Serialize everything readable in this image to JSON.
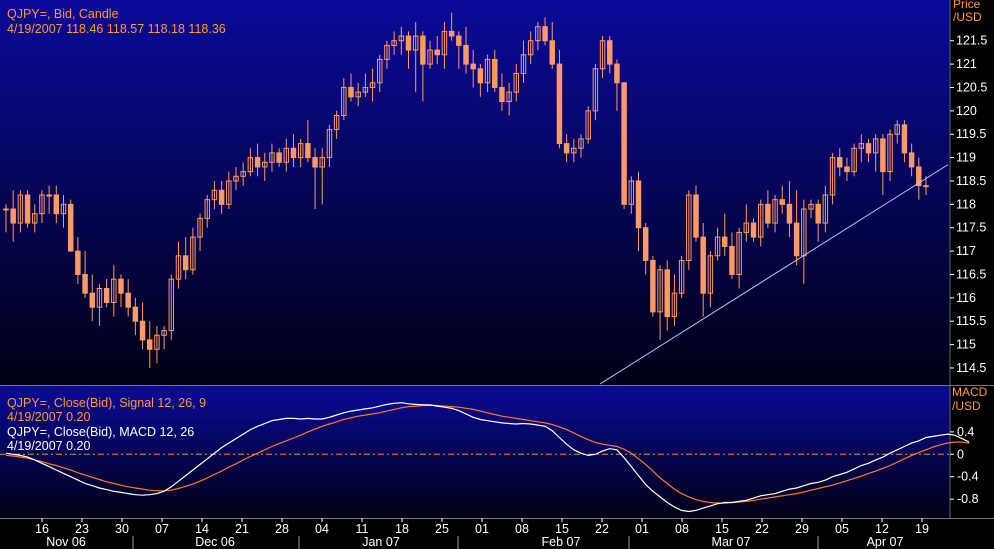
{
  "colors": {
    "bg_top": "#0a0a9a",
    "bg_bottom": "#000014",
    "candle": "#ff9966",
    "info_orange": "#ff9933",
    "info_white": "#ffffff",
    "axis_label": "#ffffff",
    "macd_line": "#ffffff",
    "signal_line": "#ff7a1a",
    "zero_line": "#ff8a2a",
    "trend_line": "#b8c4ff"
  },
  "price_panel": {
    "info_line1": "QJPY=, Bid, Candle",
    "info_line2": "4/19/2007 118.46 118.57 118.18 118.36",
    "axis_title_1": "Price",
    "axis_title_2": "/USD"
  },
  "macd_panel": {
    "info_line1": "QJPY=, Close(Bid), Signal 12, 26, 9",
    "info_line2": "4/19/2007 0.20",
    "info_line3": "QJPY=, Close(Bid), MACD 12, 26",
    "info_line4": "4/19/2007 0.20",
    "axis_title_1": "MACD",
    "axis_title_2": "/USD"
  },
  "chart_data": [
    {
      "type": "candlestick",
      "series_name": "QJPY=, Bid, Candle",
      "ylim": [
        114.2,
        122.2
      ],
      "yticks": [
        114.5,
        115,
        115.5,
        116,
        116.5,
        117,
        117.5,
        118,
        118.5,
        119,
        119.5,
        120,
        120.5,
        121,
        121.5
      ],
      "ytick_labels": [
        "114.5",
        "115",
        "115.5",
        "116",
        "116.5",
        "117",
        "117.5",
        "118",
        "118.5",
        "119",
        "119.5",
        "120",
        "120.5",
        "121",
        "121.5"
      ],
      "candles": [
        [
          117.9,
          118.0,
          117.4,
          117.9
        ],
        [
          117.9,
          118.3,
          117.2,
          117.6
        ],
        [
          117.6,
          118.3,
          117.4,
          118.2
        ],
        [
          118.2,
          118.3,
          117.5,
          117.6
        ],
        [
          117.6,
          118.0,
          117.4,
          117.8
        ],
        [
          117.8,
          118.3,
          117.6,
          118.2
        ],
        [
          118.2,
          118.4,
          117.8,
          118.2
        ],
        [
          118.2,
          118.4,
          117.6,
          117.8
        ],
        [
          117.8,
          118.2,
          117.5,
          118.0
        ],
        [
          118.0,
          118.1,
          117.0,
          117.0
        ],
        [
          117.0,
          117.3,
          116.3,
          116.5
        ],
        [
          116.5,
          117.0,
          116.0,
          116.1
        ],
        [
          116.1,
          116.5,
          115.5,
          115.8
        ],
        [
          115.8,
          116.3,
          115.4,
          116.2
        ],
        [
          116.2,
          116.4,
          115.8,
          115.9
        ],
        [
          115.9,
          116.7,
          115.6,
          116.4
        ],
        [
          116.4,
          116.5,
          115.8,
          116.1
        ],
        [
          116.1,
          116.4,
          115.6,
          115.8
        ],
        [
          115.8,
          116.0,
          115.2,
          115.5
        ],
        [
          115.5,
          115.9,
          114.9,
          115.1
        ],
        [
          115.1,
          115.5,
          114.5,
          114.9
        ],
        [
          114.9,
          115.4,
          114.6,
          115.2
        ],
        [
          115.2,
          115.4,
          114.9,
          115.3
        ],
        [
          115.3,
          116.5,
          115.1,
          116.4
        ],
        [
          116.4,
          117.2,
          116.2,
          116.9
        ],
        [
          116.9,
          117.3,
          116.4,
          116.6
        ],
        [
          116.6,
          117.5,
          116.5,
          117.3
        ],
        [
          117.3,
          117.8,
          117.0,
          117.7
        ],
        [
          117.7,
          118.2,
          117.5,
          118.1
        ],
        [
          118.1,
          118.5,
          117.9,
          118.3
        ],
        [
          118.3,
          118.5,
          117.8,
          118.0
        ],
        [
          118.0,
          118.7,
          117.9,
          118.5
        ],
        [
          118.5,
          118.8,
          118.3,
          118.6
        ],
        [
          118.6,
          118.9,
          118.4,
          118.7
        ],
        [
          118.7,
          119.2,
          118.6,
          119.0
        ],
        [
          119.0,
          119.3,
          118.6,
          118.8
        ],
        [
          118.8,
          119.1,
          118.5,
          118.9
        ],
        [
          118.9,
          119.3,
          118.7,
          119.1
        ],
        [
          119.1,
          119.2,
          118.8,
          118.9
        ],
        [
          118.9,
          119.4,
          118.7,
          119.2
        ],
        [
          119.2,
          119.5,
          118.8,
          119.0
        ],
        [
          119.0,
          119.4,
          118.8,
          119.3
        ],
        [
          119.3,
          119.8,
          118.9,
          119.0
        ],
        [
          119.0,
          119.2,
          117.9,
          118.8
        ],
        [
          118.8,
          119.2,
          118.0,
          119.0
        ],
        [
          119.0,
          119.7,
          118.8,
          119.6
        ],
        [
          119.6,
          120.0,
          119.4,
          119.9
        ],
        [
          119.9,
          120.7,
          119.8,
          120.5
        ],
        [
          120.5,
          120.8,
          120.2,
          120.3
        ],
        [
          120.3,
          120.6,
          120.1,
          120.4
        ],
        [
          120.4,
          120.8,
          120.3,
          120.5
        ],
        [
          120.5,
          120.9,
          120.2,
          120.6
        ],
        [
          120.6,
          121.2,
          120.4,
          121.1
        ],
        [
          121.1,
          121.5,
          120.9,
          121.4
        ],
        [
          121.4,
          121.7,
          121.2,
          121.5
        ],
        [
          121.5,
          121.8,
          121.2,
          121.6
        ],
        [
          121.6,
          121.7,
          120.9,
          121.3
        ],
        [
          121.3,
          121.9,
          120.4,
          121.6
        ],
        [
          121.6,
          121.7,
          120.2,
          121.0
        ],
        [
          121.0,
          121.5,
          120.9,
          121.3
        ],
        [
          121.3,
          121.6,
          121.0,
          121.2
        ],
        [
          121.2,
          121.9,
          120.9,
          121.7
        ],
        [
          121.7,
          122.1,
          121.5,
          121.6
        ],
        [
          121.6,
          121.7,
          120.9,
          121.4
        ],
        [
          121.4,
          121.8,
          120.8,
          121.0
        ],
        [
          121.0,
          121.3,
          120.5,
          120.9
        ],
        [
          120.9,
          121.0,
          120.3,
          120.6
        ],
        [
          120.6,
          121.2,
          120.4,
          121.1
        ],
        [
          121.1,
          121.3,
          120.4,
          120.5
        ],
        [
          120.5,
          120.8,
          120.0,
          120.2
        ],
        [
          120.2,
          120.6,
          119.9,
          120.4
        ],
        [
          120.4,
          121.0,
          120.2,
          120.8
        ],
        [
          120.8,
          121.5,
          120.6,
          121.2
        ],
        [
          121.2,
          121.7,
          121.0,
          121.5
        ],
        [
          121.5,
          121.9,
          121.3,
          121.8
        ],
        [
          121.8,
          122.0,
          121.4,
          121.5
        ],
        [
          121.5,
          121.9,
          120.9,
          121.0
        ],
        [
          121.0,
          121.3,
          119.2,
          119.3
        ],
        [
          119.3,
          119.5,
          118.9,
          119.1
        ],
        [
          119.1,
          119.4,
          118.9,
          119.2
        ],
        [
          119.2,
          119.5,
          119.0,
          119.4
        ],
        [
          119.4,
          120.1,
          119.3,
          120.0
        ],
        [
          120.0,
          121.0,
          119.8,
          120.9
        ],
        [
          120.9,
          121.6,
          120.7,
          121.5
        ],
        [
          121.5,
          121.6,
          120.8,
          121.0
        ],
        [
          121.0,
          121.1,
          120.0,
          120.6
        ],
        [
          120.6,
          120.6,
          117.9,
          118.0
        ],
        [
          118.0,
          118.6,
          117.8,
          118.5
        ],
        [
          118.5,
          118.7,
          117.0,
          117.5
        ],
        [
          117.5,
          117.6,
          116.5,
          116.8
        ],
        [
          116.8,
          116.9,
          115.6,
          115.7
        ],
        [
          115.7,
          116.7,
          115.1,
          116.6
        ],
        [
          116.6,
          116.8,
          115.3,
          115.6
        ],
        [
          115.6,
          116.5,
          115.4,
          116.1
        ],
        [
          116.1,
          116.9,
          116.0,
          116.8
        ],
        [
          116.8,
          118.3,
          116.6,
          118.2
        ],
        [
          118.2,
          118.4,
          117.2,
          117.3
        ],
        [
          117.3,
          117.6,
          115.6,
          116.1
        ],
        [
          116.1,
          117.0,
          115.8,
          116.9
        ],
        [
          116.9,
          117.5,
          116.8,
          117.3
        ],
        [
          117.3,
          117.8,
          116.9,
          117.1
        ],
        [
          117.1,
          117.4,
          116.4,
          116.5
        ],
        [
          116.5,
          117.5,
          116.2,
          117.4
        ],
        [
          117.4,
          118.0,
          117.2,
          117.6
        ],
        [
          117.6,
          117.7,
          117.2,
          117.3
        ],
        [
          117.3,
          118.1,
          117.1,
          118.0
        ],
        [
          118.0,
          118.3,
          117.5,
          117.6
        ],
        [
          117.6,
          118.2,
          117.4,
          118.1
        ],
        [
          118.1,
          118.4,
          117.8,
          118.0
        ],
        [
          118.0,
          118.5,
          117.3,
          117.6
        ],
        [
          117.6,
          118.3,
          116.7,
          116.9
        ],
        [
          116.9,
          118.1,
          116.3,
          117.9
        ],
        [
          117.9,
          118.1,
          117.7,
          118.0
        ],
        [
          118.0,
          118.1,
          117.2,
          117.6
        ],
        [
          117.6,
          118.4,
          117.4,
          118.2
        ],
        [
          118.2,
          119.1,
          118.0,
          119.0
        ],
        [
          119.0,
          119.2,
          118.6,
          118.8
        ],
        [
          118.8,
          119.0,
          118.5,
          118.7
        ],
        [
          118.7,
          119.3,
          118.6,
          119.2
        ],
        [
          119.2,
          119.5,
          118.9,
          119.3
        ],
        [
          119.3,
          119.4,
          118.9,
          119.1
        ],
        [
          119.1,
          119.5,
          118.7,
          119.4
        ],
        [
          119.4,
          119.5,
          118.2,
          118.7
        ],
        [
          118.7,
          119.6,
          118.5,
          119.5
        ],
        [
          119.5,
          119.8,
          119.3,
          119.7
        ],
        [
          119.7,
          119.8,
          118.9,
          119.1
        ],
        [
          119.1,
          119.3,
          118.6,
          118.8
        ],
        [
          118.8,
          119.0,
          118.1,
          118.4
        ],
        [
          118.4,
          118.6,
          118.2,
          118.4
        ]
      ]
    },
    {
      "type": "line",
      "ylim": [
        -1.1,
        1.2
      ],
      "yticks": [
        0.4,
        0,
        -0.4,
        -0.8
      ],
      "ytick_labels": [
        "0.4",
        "0",
        "-0.4",
        "-0.8"
      ],
      "zero_line": 0,
      "series": [
        {
          "name": "MACD 12, 26",
          "values": [
            0.02,
            0.0,
            -0.02,
            -0.05,
            -0.1,
            -0.16,
            -0.22,
            -0.28,
            -0.34,
            -0.4,
            -0.46,
            -0.52,
            -0.56,
            -0.6,
            -0.63,
            -0.66,
            -0.68,
            -0.7,
            -0.72,
            -0.73,
            -0.72,
            -0.7,
            -0.66,
            -0.58,
            -0.48,
            -0.38,
            -0.28,
            -0.18,
            -0.08,
            0.02,
            0.12,
            0.2,
            0.28,
            0.36,
            0.44,
            0.5,
            0.55,
            0.6,
            0.62,
            0.64,
            0.64,
            0.63,
            0.64,
            0.63,
            0.63,
            0.66,
            0.7,
            0.74,
            0.77,
            0.79,
            0.81,
            0.83,
            0.86,
            0.89,
            0.91,
            0.92,
            0.9,
            0.89,
            0.88,
            0.88,
            0.86,
            0.84,
            0.82,
            0.78,
            0.72,
            0.66,
            0.62,
            0.6,
            0.58,
            0.56,
            0.55,
            0.54,
            0.55,
            0.54,
            0.52,
            0.5,
            0.42,
            0.3,
            0.18,
            0.08,
            0.02,
            -0.02,
            0.0,
            0.06,
            0.1,
            0.08,
            -0.06,
            -0.22,
            -0.38,
            -0.54,
            -0.66,
            -0.76,
            -0.86,
            -0.94,
            -1.0,
            -1.02,
            -1.0,
            -0.96,
            -0.92,
            -0.88,
            -0.86,
            -0.86,
            -0.84,
            -0.82,
            -0.78,
            -0.74,
            -0.72,
            -0.7,
            -0.66,
            -0.62,
            -0.6,
            -0.56,
            -0.52,
            -0.5,
            -0.46,
            -0.4,
            -0.36,
            -0.32,
            -0.26,
            -0.2,
            -0.16,
            -0.1,
            -0.05,
            0.02,
            0.08,
            0.14,
            0.2,
            0.24,
            0.3,
            0.32,
            0.34,
            0.36,
            0.34,
            0.28,
            0.22
          ]
        },
        {
          "name": "Signal 12, 26, 9",
          "values": [
            -0.02,
            -0.03,
            -0.05,
            -0.07,
            -0.1,
            -0.13,
            -0.17,
            -0.2,
            -0.24,
            -0.28,
            -0.33,
            -0.37,
            -0.41,
            -0.45,
            -0.49,
            -0.52,
            -0.55,
            -0.58,
            -0.6,
            -0.62,
            -0.64,
            -0.65,
            -0.65,
            -0.64,
            -0.61,
            -0.57,
            -0.53,
            -0.48,
            -0.42,
            -0.36,
            -0.3,
            -0.23,
            -0.17,
            -0.1,
            -0.04,
            0.02,
            0.08,
            0.14,
            0.19,
            0.24,
            0.29,
            0.34,
            0.4,
            0.45,
            0.5,
            0.54,
            0.58,
            0.62,
            0.65,
            0.68,
            0.7,
            0.72,
            0.74,
            0.77,
            0.8,
            0.83,
            0.85,
            0.86,
            0.87,
            0.87,
            0.87,
            0.86,
            0.85,
            0.84,
            0.82,
            0.8,
            0.77,
            0.74,
            0.71,
            0.68,
            0.66,
            0.64,
            0.62,
            0.6,
            0.58,
            0.56,
            0.53,
            0.49,
            0.44,
            0.38,
            0.32,
            0.26,
            0.21,
            0.18,
            0.16,
            0.14,
            0.09,
            0.02,
            -0.08,
            -0.18,
            -0.3,
            -0.42,
            -0.52,
            -0.62,
            -0.7,
            -0.76,
            -0.81,
            -0.84,
            -0.86,
            -0.87,
            -0.87,
            -0.86,
            -0.85,
            -0.84,
            -0.82,
            -0.8,
            -0.78,
            -0.76,
            -0.74,
            -0.72,
            -0.7,
            -0.67,
            -0.64,
            -0.61,
            -0.58,
            -0.55,
            -0.51,
            -0.47,
            -0.43,
            -0.39,
            -0.34,
            -0.3,
            -0.25,
            -0.2,
            -0.14,
            -0.08,
            -0.02,
            0.03,
            0.08,
            0.13,
            0.17,
            0.2,
            0.22,
            0.22,
            0.2
          ]
        }
      ]
    }
  ],
  "time_axis": {
    "day_ticks": [
      "16",
      "23",
      "30",
      "07",
      "14",
      "21",
      "28",
      "04",
      "11",
      "18",
      "25",
      "01",
      "08",
      "15",
      "22",
      "01",
      "08",
      "15",
      "22",
      "29",
      "05",
      "12",
      "19"
    ],
    "months": [
      "Nov 06",
      "Dec 06",
      "Jan 07",
      "Feb 07",
      "Mar 07",
      "Apr 07"
    ]
  }
}
